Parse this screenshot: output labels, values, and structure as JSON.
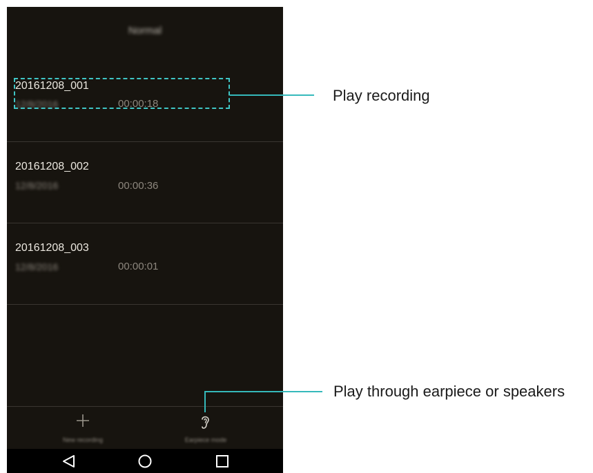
{
  "app": {
    "title": "Normal"
  },
  "recordings": [
    {
      "name": "20161208_001",
      "date": "12/8/2016",
      "duration": "00:00:18"
    },
    {
      "name": "20161208_002",
      "date": "12/8/2016",
      "duration": "00:00:36"
    },
    {
      "name": "20161208_003",
      "date": "12/8/2016",
      "duration": "00:00:01"
    }
  ],
  "bottom_bar": {
    "new_recording": {
      "label": "New recording",
      "icon": "plus-icon"
    },
    "earpiece_mode": {
      "label": "Earpiece mode",
      "icon": "ear-icon"
    }
  },
  "nav_bar": {
    "back_icon": "back-triangle-icon",
    "home_icon": "home-circle-icon",
    "recents_icon": "recents-square-icon"
  },
  "callouts": {
    "play_recording": "Play recording",
    "play_through": "Play through earpiece or speakers"
  },
  "colors": {
    "background": "#17140f",
    "callout_accent": "#35b9bb",
    "primary_text": "#ece8e0",
    "secondary_text": "#8d877e"
  }
}
